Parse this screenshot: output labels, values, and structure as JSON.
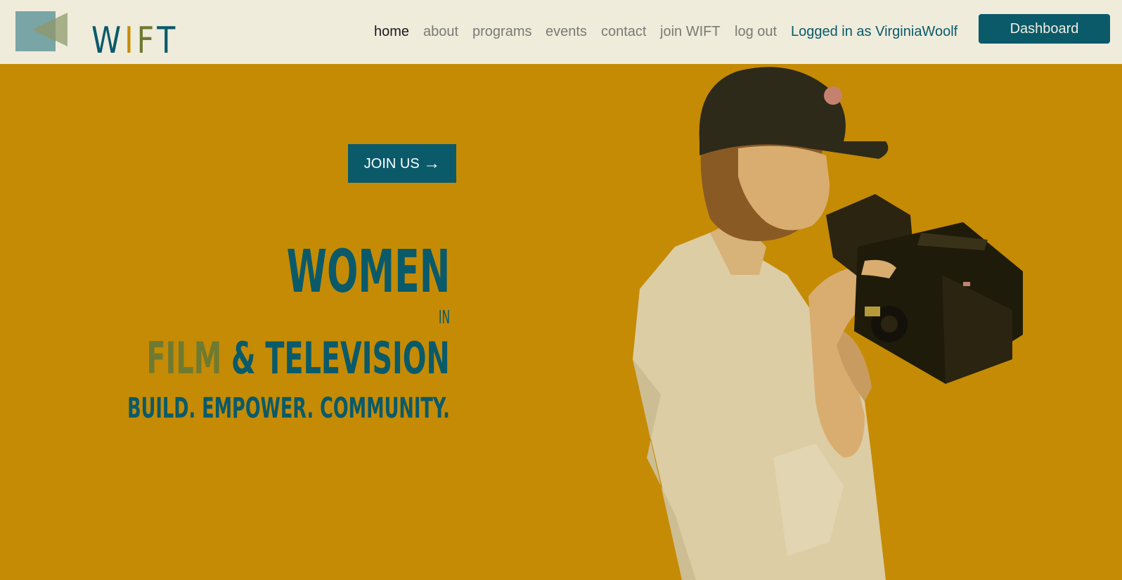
{
  "header": {
    "logo_text": "WIFT",
    "logo_letters": [
      {
        "char": "W",
        "color": "#0a5a6a"
      },
      {
        "char": "I",
        "color": "#c58b04"
      },
      {
        "char": "F",
        "color": "#6f7a31"
      },
      {
        "char": "T",
        "color": "#0a5a6a"
      }
    ],
    "nav": {
      "home": "home",
      "about": "about",
      "programs": "programs",
      "events": "events",
      "contact": "contact",
      "join": "join WIFT",
      "logout": "log out",
      "user": "Logged in as VirginiaWoolf"
    },
    "dashboard_label": "Dashboard"
  },
  "hero": {
    "join_label": "JOIN US",
    "join_arrow": "→",
    "headline_women": "WOMEN",
    "headline_in": "IN",
    "headline_film": "FILM",
    "headline_rest": " & TELEVISION",
    "tagline": "BUILD. EMPOWER. COMMUNITY.",
    "image_alt": "woman-with-camera-icon"
  },
  "colors": {
    "brand_teal": "#0a5a6a",
    "brand_gold": "#c58b04",
    "brand_olive": "#6f7a31",
    "header_bg": "#efecdc"
  }
}
